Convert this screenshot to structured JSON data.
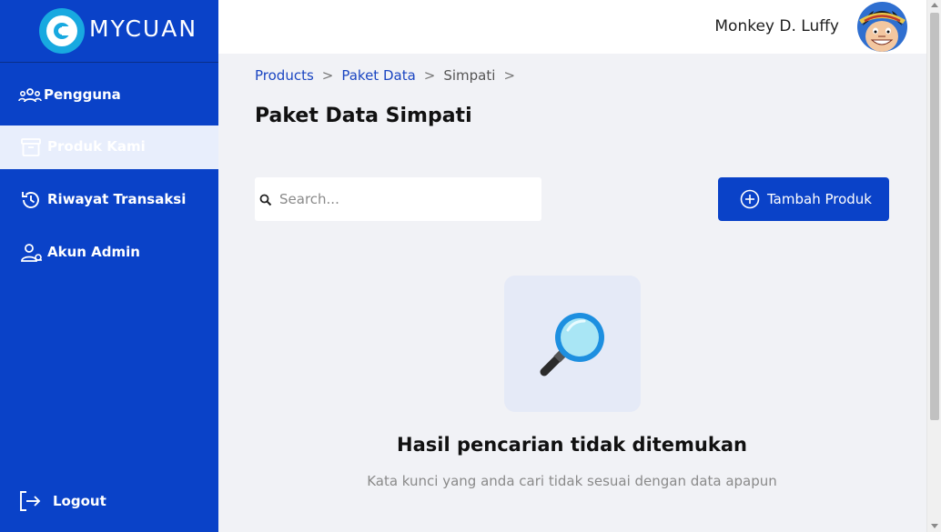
{
  "brand": {
    "name": "MYCUAN"
  },
  "sidebar": {
    "items": [
      {
        "label": "Pengguna",
        "icon": "users-icon",
        "active": false
      },
      {
        "label": "Produk Kami",
        "icon": "archive-box-icon",
        "active": true
      },
      {
        "label": "Riwayat Transaksi",
        "icon": "history-icon",
        "active": false
      },
      {
        "label": "Akun Admin",
        "icon": "user-cog-icon",
        "active": false
      }
    ],
    "logout_label": "Logout"
  },
  "header": {
    "user_name": "Monkey D. Luffy"
  },
  "breadcrumb": [
    {
      "label": "Products",
      "link": true
    },
    {
      "label": "Paket Data",
      "link": true
    },
    {
      "label": "Simpati",
      "link": false
    }
  ],
  "breadcrumb_separator": ">",
  "page": {
    "title": "Paket Data Simpati",
    "search_placeholder": "Search...",
    "search_value": "",
    "add_button_label": "Tambah Produk"
  },
  "empty_state": {
    "title": "Hasil pencarian tidak ditemukan",
    "description": "Kata kunci yang anda cari tidak sesuai dengan data apapun"
  },
  "colors": {
    "primary": "#0a42c8",
    "active_item_bg": "#e8eefc",
    "background": "#f1f2f6"
  }
}
